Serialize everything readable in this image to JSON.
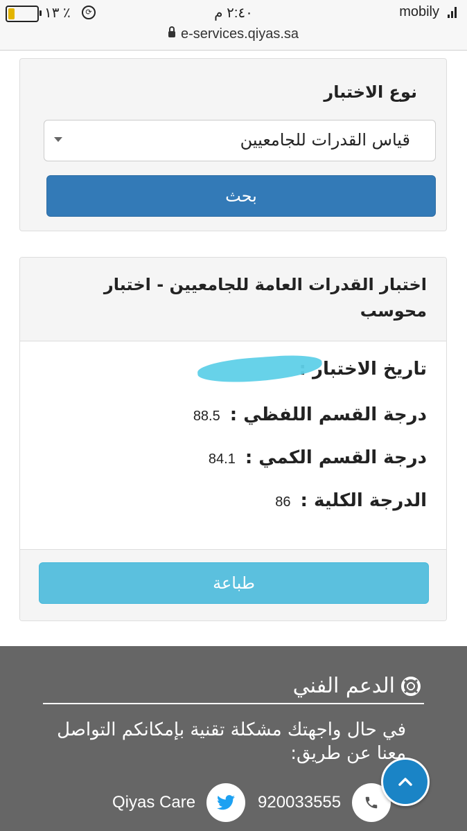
{
  "status_bar": {
    "battery_level": 0.22,
    "battery_percent": "١٣ ٪",
    "time": "٢:٤٠ م",
    "carrier": "mobily",
    "url": "e-services.qiyas.sa"
  },
  "search": {
    "label": "نوع الاختبار",
    "selected_test": "قياس القدرات للجامعيين",
    "search_button": "بحث"
  },
  "result": {
    "title": "اختبار القدرات العامة للجامعيين - اختبار محوسب",
    "date_label": "تاريخ الاختبار :",
    "verbal_label": "درجة القسم اللفظي :",
    "verbal_score": "88.5",
    "quant_label": "درجة القسم الكمي :",
    "quant_score": "84.1",
    "total_label": "الدرجة الكلية :",
    "total_score": "86",
    "print_button": "طباعة"
  },
  "footer": {
    "support_title": "الدعم الفني",
    "support_text": "في حال واجهتك مشكلة تقنية بإمكانكم التواصل معنا عن طريق:",
    "twitter_handle": "Qiyas Care",
    "phone_number": "920033555"
  },
  "colors": {
    "primary_button": "#337ab7",
    "info_button": "#5bc0de",
    "footer_bg": "#666666",
    "scroll_top": "#1a84c6",
    "twitter_blue": "#1da1f2"
  }
}
